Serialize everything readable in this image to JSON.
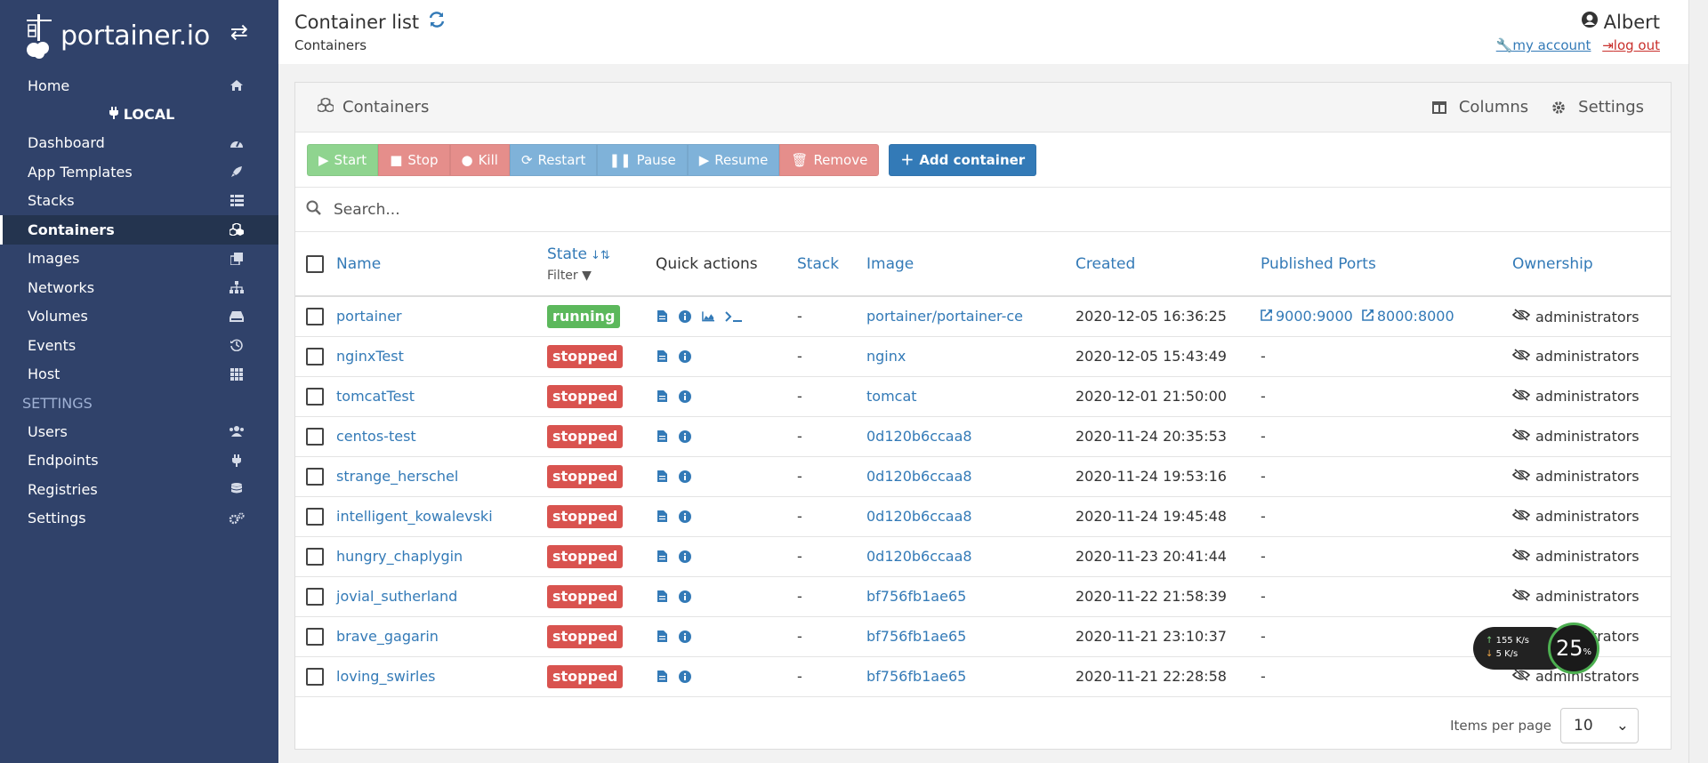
{
  "brand": {
    "logo_text": "portainer.io",
    "toggle_icon": "exchange-icon"
  },
  "sidebar": {
    "items_top": [
      {
        "label": "Home",
        "icon": "home-icon"
      }
    ],
    "endpoint": "LOCAL",
    "items": [
      {
        "label": "Dashboard",
        "icon": "tachometer-icon"
      },
      {
        "label": "App Templates",
        "icon": "rocket-icon"
      },
      {
        "label": "Stacks",
        "icon": "th-list-icon"
      },
      {
        "label": "Containers",
        "icon": "cubes-icon",
        "active": true
      },
      {
        "label": "Images",
        "icon": "clone-icon"
      },
      {
        "label": "Networks",
        "icon": "sitemap-icon"
      },
      {
        "label": "Volumes",
        "icon": "hdd-icon"
      },
      {
        "label": "Events",
        "icon": "history-icon"
      },
      {
        "label": "Host",
        "icon": "th-icon"
      }
    ],
    "settings_header": "SETTINGS",
    "settings_items": [
      {
        "label": "Users",
        "icon": "users-icon"
      },
      {
        "label": "Endpoints",
        "icon": "plug-icon"
      },
      {
        "label": "Registries",
        "icon": "database-icon"
      },
      {
        "label": "Settings",
        "icon": "cogs-icon"
      }
    ]
  },
  "header": {
    "title": "Container list",
    "breadcrumb": "Containers",
    "user": "Albert",
    "my_account": "my account",
    "log_out": "log out"
  },
  "widget": {
    "title": "Containers",
    "columns_label": "Columns",
    "settings_label": "Settings",
    "buttons": {
      "start": "Start",
      "stop": "Stop",
      "kill": "Kill",
      "restart": "Restart",
      "pause": "Pause",
      "resume": "Resume",
      "remove": "Remove",
      "add": "Add container"
    },
    "search_placeholder": "Search...",
    "columns": {
      "name": "Name",
      "state": "State",
      "filter": "Filter",
      "quick_actions": "Quick actions",
      "stack": "Stack",
      "image": "Image",
      "created": "Created",
      "ports": "Published Ports",
      "ownership": "Ownership"
    },
    "rows": [
      {
        "name": "portainer",
        "state": "running",
        "stack": "-",
        "image": "portainer/portainer-ce",
        "created": "2020-12-05 16:36:25",
        "ports": [
          "9000:9000",
          "8000:8000"
        ],
        "ownership": "administrators"
      },
      {
        "name": "nginxTest",
        "state": "stopped",
        "stack": "-",
        "image": "nginx",
        "created": "2020-12-05 15:43:49",
        "ports": [],
        "ownership": "administrators"
      },
      {
        "name": "tomcatTest",
        "state": "stopped",
        "stack": "-",
        "image": "tomcat",
        "created": "2020-12-01 21:50:00",
        "ports": [],
        "ownership": "administrators"
      },
      {
        "name": "centos-test",
        "state": "stopped",
        "stack": "-",
        "image": "0d120b6ccaa8",
        "created": "2020-11-24 20:35:53",
        "ports": [],
        "ownership": "administrators"
      },
      {
        "name": "strange_herschel",
        "state": "stopped",
        "stack": "-",
        "image": "0d120b6ccaa8",
        "created": "2020-11-24 19:53:16",
        "ports": [],
        "ownership": "administrators"
      },
      {
        "name": "intelligent_kowalevski",
        "state": "stopped",
        "stack": "-",
        "image": "0d120b6ccaa8",
        "created": "2020-11-24 19:45:48",
        "ports": [],
        "ownership": "administrators"
      },
      {
        "name": "hungry_chaplygin",
        "state": "stopped",
        "stack": "-",
        "image": "0d120b6ccaa8",
        "created": "2020-11-23 20:41:44",
        "ports": [],
        "ownership": "administrators"
      },
      {
        "name": "jovial_sutherland",
        "state": "stopped",
        "stack": "-",
        "image": "bf756fb1ae65",
        "created": "2020-11-22 21:58:39",
        "ports": [],
        "ownership": "administrators"
      },
      {
        "name": "brave_gagarin",
        "state": "stopped",
        "stack": "-",
        "image": "bf756fb1ae65",
        "created": "2020-11-21 23:10:37",
        "ports": [],
        "ownership": "administrators"
      },
      {
        "name": "loving_swirles",
        "state": "stopped",
        "stack": "-",
        "image": "bf756fb1ae65",
        "created": "2020-11-21 22:28:58",
        "ports": [],
        "ownership": "administrators"
      }
    ],
    "ports_empty": "-",
    "items_per_page_label": "Items per page",
    "items_per_page": "10"
  },
  "netspeed": {
    "up": "155 K/s",
    "down": "5  K/s",
    "percent": "25",
    "percent_unit": "%"
  },
  "colors": {
    "sidebar": "#30426a",
    "primary": "#337ab7",
    "running": "#5cb85c",
    "stopped": "#d9534f"
  }
}
